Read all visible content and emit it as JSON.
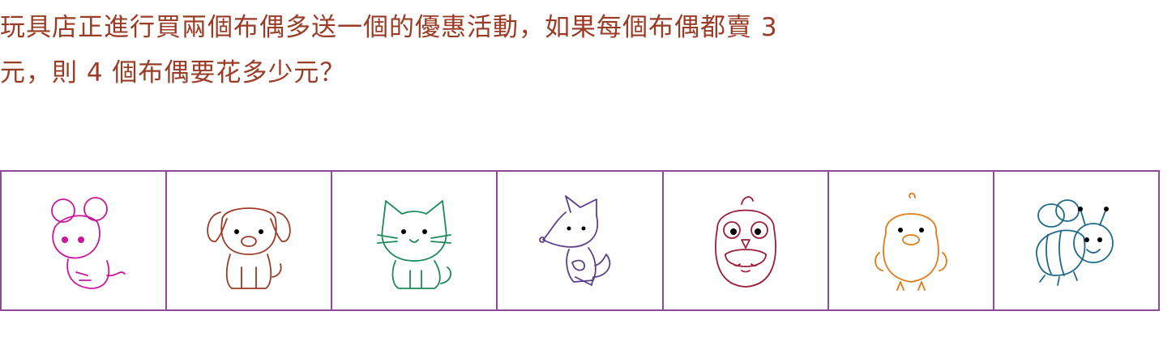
{
  "question": {
    "line1": "玩具店正進行買兩個布偶多送一個的優惠活動，如果每個布偶都賣 3",
    "line2": "元，則 4 個布偶要花多少元？"
  },
  "toys": [
    {
      "name": "mouse-plush",
      "icon": "mouse-icon",
      "color": "#c8189a"
    },
    {
      "name": "dog-plush",
      "icon": "dog-icon",
      "color": "#9a3b25"
    },
    {
      "name": "cat-plush",
      "icon": "cat-icon",
      "color": "#1f8a5a"
    },
    {
      "name": "fox-plush",
      "icon": "fox-icon",
      "color": "#5a3f8a"
    },
    {
      "name": "owl-plush",
      "icon": "owl-icon",
      "color": "#9a1f3a"
    },
    {
      "name": "chick-plush",
      "icon": "chick-icon",
      "color": "#e07a1a"
    },
    {
      "name": "bee-plush",
      "icon": "bee-icon",
      "color": "#1f6a8a"
    }
  ]
}
